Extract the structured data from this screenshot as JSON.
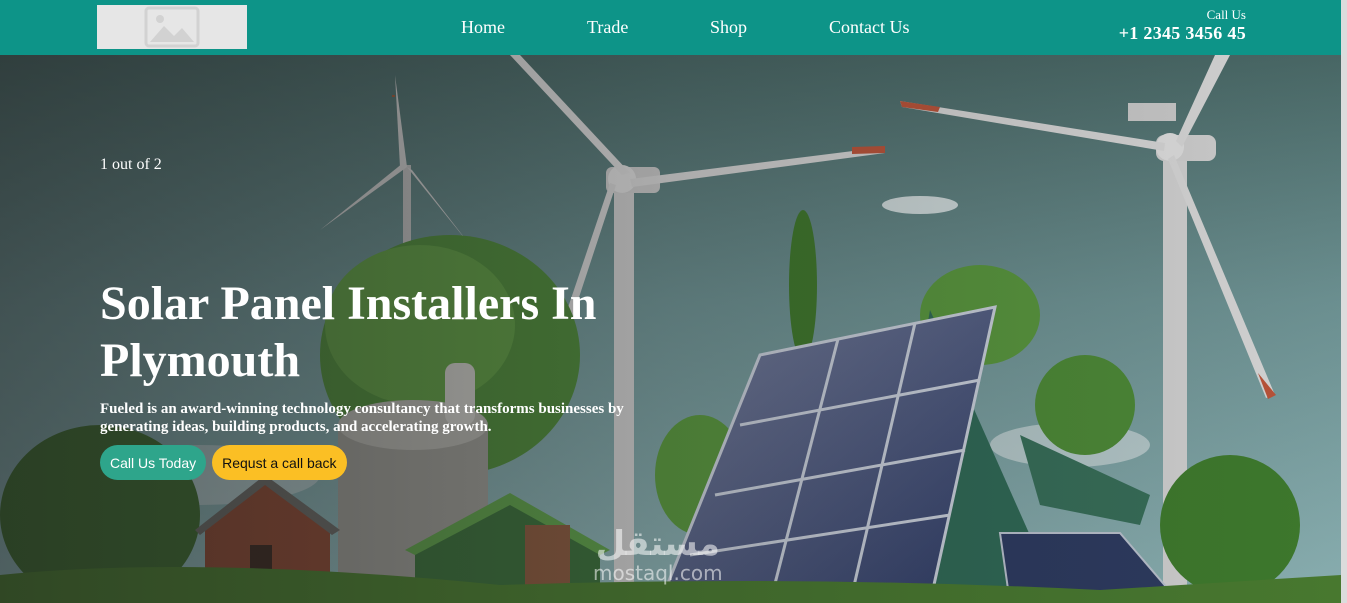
{
  "header": {
    "logo_icon": "image-placeholder-icon",
    "nav": [
      "Home",
      "Trade",
      "Shop",
      "Contact Us"
    ],
    "call_label": "Call Us",
    "phone": "+1 2345 3456 45"
  },
  "hero": {
    "slide_counter": "1 out of 2",
    "title": "Solar Panel Installers In Plymouth",
    "description": "Fueled is an award-winning technology consultancy that transforms businesses by generating ideas, building products, and accelerating growth.",
    "primary_button": "Call Us Today",
    "secondary_button": "Requst a call back",
    "watermark_arabic": "مستقل",
    "watermark_latin": "mostaql.com"
  },
  "colors": {
    "header_bg": "#0d9488",
    "primary_button": "#2ea58b",
    "secondary_button": "#fbbf24"
  }
}
